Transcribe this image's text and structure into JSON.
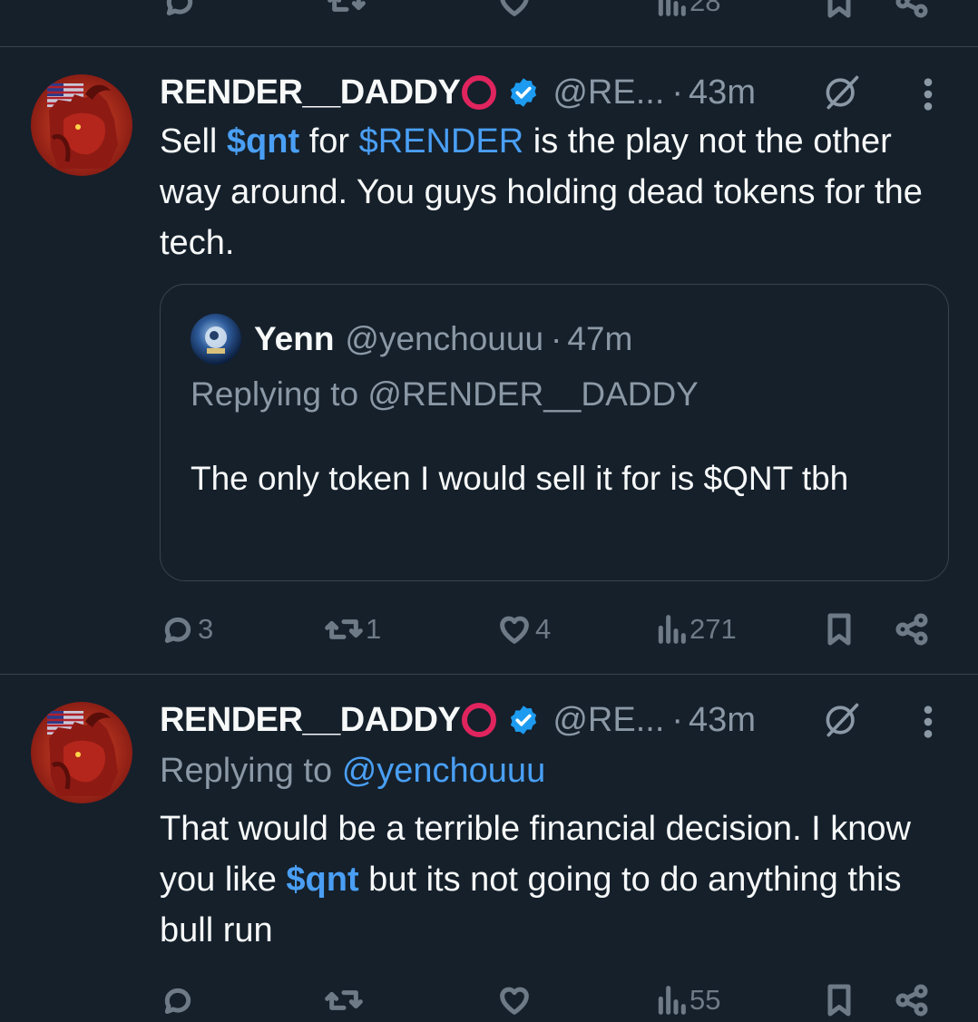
{
  "top_actions": {
    "views": "28"
  },
  "tweet1": {
    "display_name": "RENDER__DADDY",
    "handle": "@RE...",
    "dot": "·",
    "time": "43m",
    "text": [
      {
        "t": "Sell ",
        "style": "plain"
      },
      {
        "t": "$qnt",
        "style": "cashtag"
      },
      {
        "t": " for ",
        "style": "plain"
      },
      {
        "t": "$RENDER",
        "style": "link"
      },
      {
        "t": " is the play not the other way around. You guys holding dead tokens for the tech.",
        "style": "plain"
      }
    ],
    "quote": {
      "display_name": "Yenn",
      "handle": "@yenchouuu",
      "dot": "·",
      "time": "47m",
      "replying_to_label": "Replying to",
      "replying_to_handle": "@RENDER__DADDY",
      "text": "The only token I would sell it for is $QNT tbh"
    },
    "actions": {
      "replies": "3",
      "reposts": "1",
      "likes": "4",
      "views": "271"
    }
  },
  "tweet2": {
    "display_name": "RENDER__DADDY",
    "handle": "@RE...",
    "dot": "·",
    "time": "43m",
    "replying_to_label": "Replying to",
    "replying_to_handle": "@yenchouuu",
    "text": [
      {
        "t": "That would be a terrible financial decision. I know you like ",
        "style": "plain"
      },
      {
        "t": "$qnt",
        "style": "cashtag"
      },
      {
        "t": " but its not going to do anything this bull run",
        "style": "plain"
      }
    ],
    "actions": {
      "views": "55"
    }
  },
  "colors": {
    "background": "#15202b",
    "text": "#f7f9f9",
    "muted": "#8b98a5",
    "link": "#4a9ff5",
    "verified": "#1d9bf0",
    "ring": "#e0245e",
    "divider": "#38444d"
  },
  "icons": [
    "reply-icon",
    "repost-icon",
    "like-icon",
    "views-icon",
    "bookmark-icon",
    "share-icon",
    "verified-badge-icon",
    "grok-icon",
    "more-icon"
  ]
}
